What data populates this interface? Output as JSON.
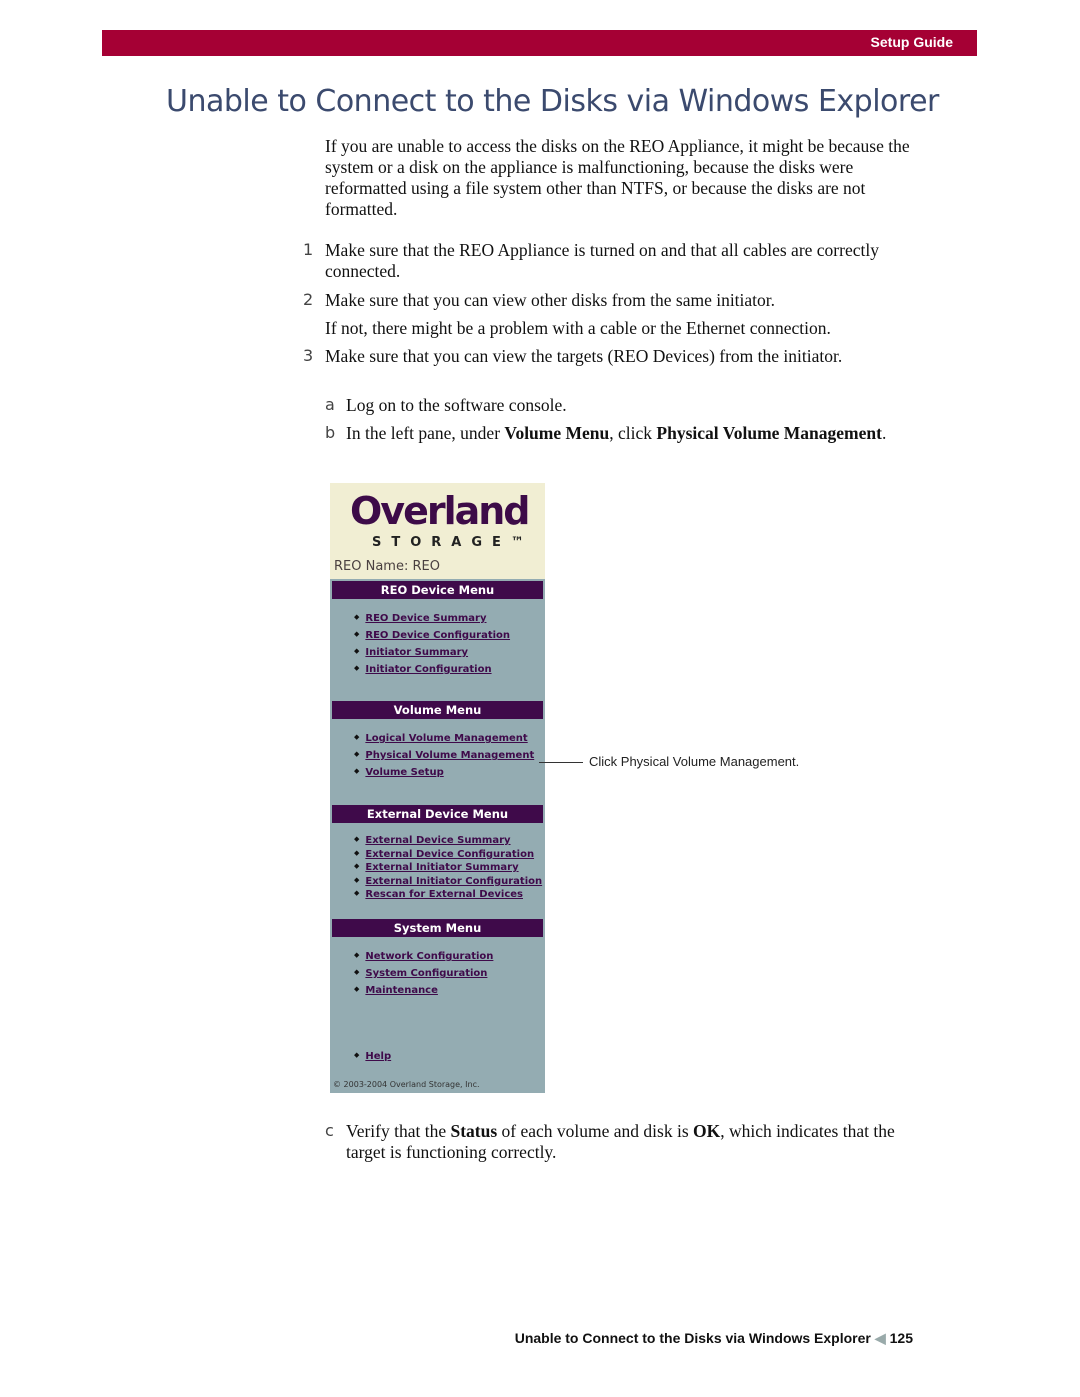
{
  "header": {
    "label": "Setup Guide",
    "color": "#a50034"
  },
  "title": "Unable to Connect to the Disks via Windows Explorer",
  "intro": "If you are unable to access the disks on the REO Appliance, it might be because the system or a disk on the appliance is malfunctioning, because the disks were reformatted using a file system other than NTFS, or because the disks are not formatted.",
  "steps": [
    {
      "num": "1",
      "text": "Make sure that the REO Appliance is turned on and that all cables are correctly connected."
    },
    {
      "num": "2",
      "text": "Make sure that you can view other disks from the same initiator.",
      "note": "If not, there might be a problem with a cable or the Ethernet connection."
    },
    {
      "num": "3",
      "text": "Make sure that you can view the targets (REO Devices) from the initiator."
    }
  ],
  "substeps": {
    "a": {
      "num": "a",
      "text": "Log on to the software console."
    },
    "b": {
      "num": "b",
      "t1": "In the left pane, under ",
      "b1": "Volume Menu",
      "t2": ", click ",
      "b2": "Physical Volume Management",
      "t3": "."
    },
    "c": {
      "num": "c",
      "t1": "Verify that the ",
      "b1": "Status",
      "t2": " of each volume and disk is ",
      "b2": "OK",
      "t3": ", which indicates that the target is functioning correctly."
    }
  },
  "screenshot": {
    "logo": "Overland",
    "logo_sub": "STORAGE™",
    "reo_name": "REO Name: REO",
    "menus": [
      {
        "title": "REO Device Menu",
        "items": [
          "REO Device Summary",
          "REO Device Configuration",
          "Initiator Summary",
          "Initiator Configuration"
        ]
      },
      {
        "title": "Volume Menu",
        "items": [
          "Logical Volume Management",
          "Physical Volume Management",
          "Volume Setup"
        ]
      },
      {
        "title": "External Device Menu",
        "items": [
          "External Device Summary",
          "External Device Configuration",
          "External Initiator Summary",
          "External Initiator Configuration",
          "Rescan for External Devices"
        ]
      },
      {
        "title": "System Menu",
        "items": [
          "Network Configuration",
          "System Configuration",
          "Maintenance"
        ]
      }
    ],
    "help": "Help",
    "copyright": "© 2003-2004 Overland Storage, Inc."
  },
  "callout": "Click Physical Volume Management.",
  "footer": {
    "title": "Unable to Connect to the Disks via Windows Explorer",
    "page": "125"
  }
}
